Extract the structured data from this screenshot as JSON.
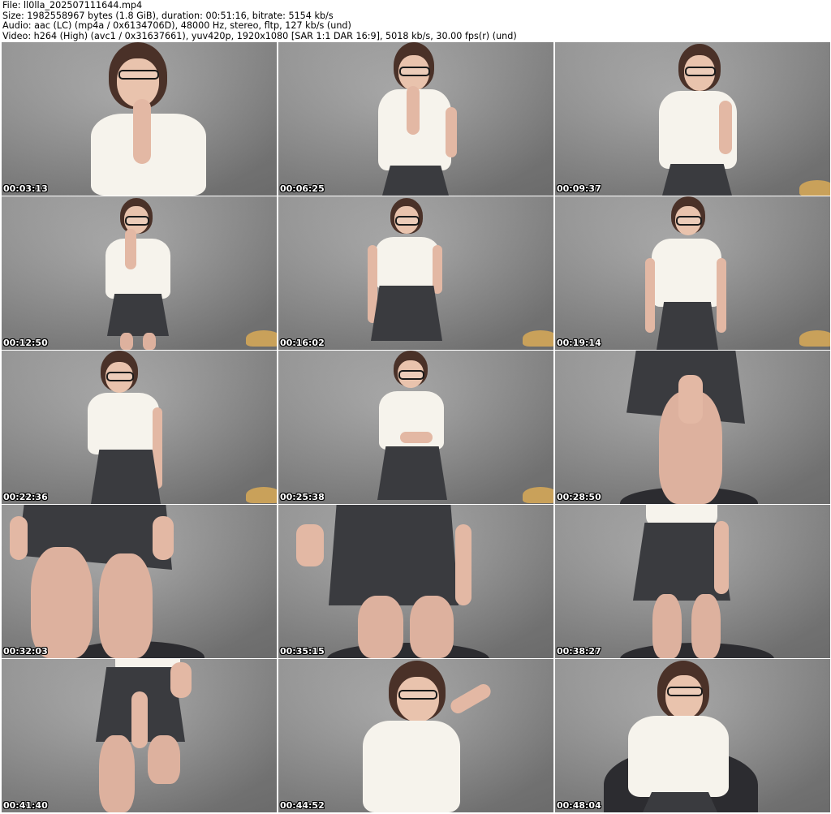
{
  "header": {
    "file": "File: ll0lla_202507111644.mp4",
    "size": "Size: 1982558967 bytes (1.8 GiB), duration: 00:51:16, bitrate: 5154 kb/s",
    "audio": "Audio: aac (LC) (mp4a / 0x6134706D), 48000 Hz, stereo, fltp, 127 kb/s (und)",
    "video": "Video: h264 (High) (avc1 / 0x31637661), yuv420p, 1920x1080 [SAR 1:1 DAR 16:9], 5018 kb/s, 30.00 fps(r) (und)"
  },
  "thumbnails": [
    {
      "timestamp": "00:03:13"
    },
    {
      "timestamp": "00:06:25"
    },
    {
      "timestamp": "00:09:37"
    },
    {
      "timestamp": "00:12:50"
    },
    {
      "timestamp": "00:16:02"
    },
    {
      "timestamp": "00:19:14"
    },
    {
      "timestamp": "00:22:36"
    },
    {
      "timestamp": "00:25:38"
    },
    {
      "timestamp": "00:28:50"
    },
    {
      "timestamp": "00:32:03"
    },
    {
      "timestamp": "00:35:15"
    },
    {
      "timestamp": "00:38:27"
    },
    {
      "timestamp": "00:41:40"
    },
    {
      "timestamp": "00:44:52"
    },
    {
      "timestamp": "00:48:04"
    }
  ],
  "colors": {
    "wall": "#8d8d8d",
    "shirt": "#f6f3ec",
    "skirt": "#3a3b3f",
    "hair": "#4a3128",
    "skin": "#e3b8a4",
    "stool": "#c9a15a"
  }
}
